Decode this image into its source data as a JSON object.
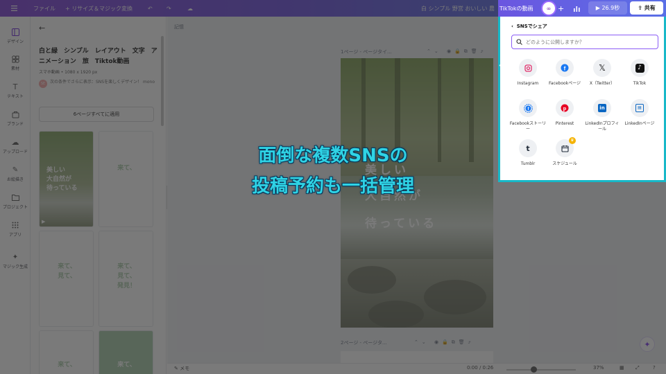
{
  "topbar": {
    "menu_icon": "hamburger-icon",
    "file": "ファイル",
    "resize": "+ リサイズ＆マジック変換",
    "doc_title": "白 シンプル 野営 おいしい 農",
    "tiktok_label": "TikTokの動画",
    "duration": "26.9秒",
    "share": "共有"
  },
  "rail": [
    {
      "label": "デザイン",
      "icon": "layout-icon"
    },
    {
      "label": "素材",
      "icon": "shapes-icon"
    },
    {
      "label": "テキスト",
      "icon": "text-icon"
    },
    {
      "label": "ブランド",
      "icon": "brand-icon"
    },
    {
      "label": "アップロード",
      "icon": "cloud-upload-icon"
    },
    {
      "label": "お絵描き",
      "icon": "draw-icon"
    },
    {
      "label": "プロジェクト",
      "icon": "folder-icon"
    },
    {
      "label": "アプリ",
      "icon": "apps-icon"
    },
    {
      "label": "マジック生成",
      "icon": "magic-icon"
    }
  ],
  "panel": {
    "back_icon": "arrow-left-icon",
    "title": "白と緑　シンプル　レイアウト　文字　アニメーション　旅　Tiktok動画",
    "meta": "スマホ動画 • 1080 x 1920 px",
    "promo": "次の条件でさらに表示：SNSを楽しくデザイン！ mono",
    "promo_badge": "SE",
    "apply_all": "6ページすべてに適用",
    "thumbs": [
      {
        "text": "美しい\n大自然が\n待っている"
      },
      {
        "text": "来て、"
      },
      {
        "text": "来て、\n見て、"
      },
      {
        "text": "来て、\n見て、\n発見！"
      },
      {
        "text": "来て、"
      },
      {
        "text": "来て、"
      }
    ]
  },
  "workspace": {
    "notes_label": "記憶",
    "page1_label": "1ページ - ページタイ...",
    "page2_label": "2ページ - ページタ...",
    "canvas_text_1": "美しい",
    "canvas_text_2": "大自然が",
    "canvas_text_3": "待っている"
  },
  "bottombar": {
    "notes": "メモ",
    "time": "0:00 / 0:26",
    "zoom": "37%",
    "help": "?"
  },
  "share_popup": {
    "title": "SNSでシェア",
    "search_placeholder": "どのように公開しますか？",
    "items": [
      {
        "label": "Instagram",
        "icon": "instagram-icon",
        "color": "#e1306c"
      },
      {
        "label": "Facebookページ",
        "icon": "facebook-icon",
        "color": "#1877f2"
      },
      {
        "label": "X（Twitter）",
        "icon": "x-twitter-icon",
        "color": "#111111"
      },
      {
        "label": "TikTok",
        "icon": "tiktok-icon",
        "color": "#111111"
      },
      {
        "label": "Facebookストーリー",
        "icon": "facebook-story-icon",
        "color": "#1877f2"
      },
      {
        "label": "Pinterest",
        "icon": "pinterest-icon",
        "color": "#e60023"
      },
      {
        "label": "LinkedInプロフィール",
        "icon": "linkedin-icon",
        "color": "#0a66c2"
      },
      {
        "label": "LinkedInページ",
        "icon": "linkedin-page-icon",
        "color": "#0a66c2"
      },
      {
        "label": "Tumblr",
        "icon": "tumblr-icon",
        "color": "#1f2937"
      },
      {
        "label": "スケジュール",
        "icon": "calendar-icon",
        "color": "#1f2937"
      }
    ]
  },
  "headline": {
    "line1": "面倒な複数SNSの",
    "line2": "投稿予約も一括管理"
  },
  "colors": {
    "accent": "#7d40d6",
    "highlight": "#17b8c8",
    "headline": "#2fd3e5"
  }
}
